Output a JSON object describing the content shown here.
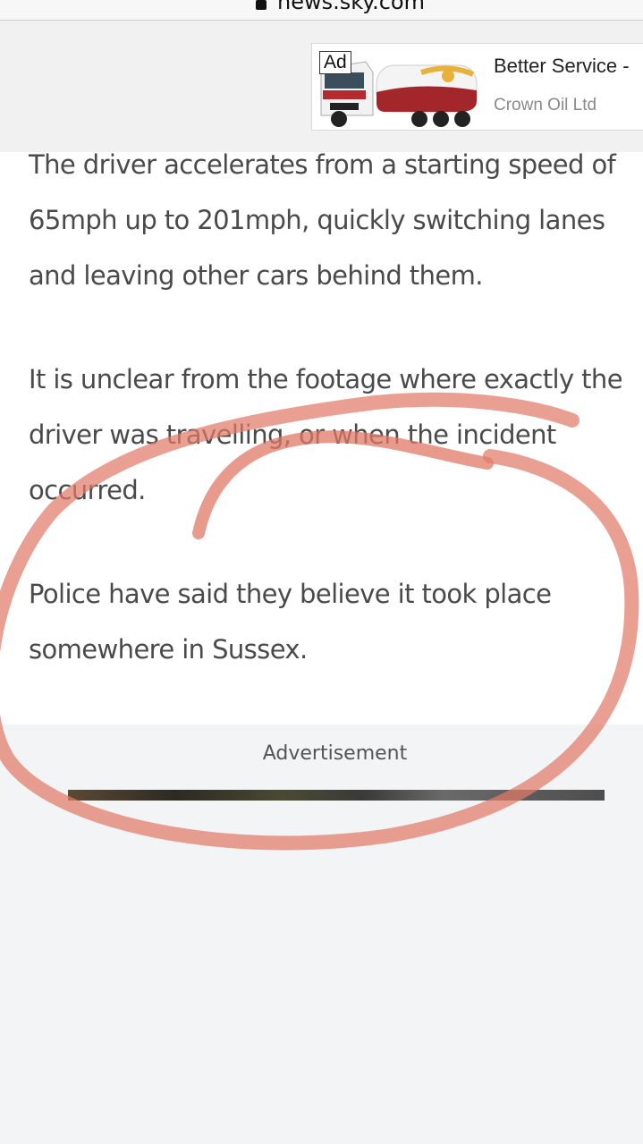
{
  "browser": {
    "url": "news.sky.com"
  },
  "ad_banner": {
    "badge": "Ad",
    "title": "Better Service -",
    "advertiser": "Crown Oil Ltd",
    "image_brand": "Crown Oil"
  },
  "article": {
    "paragraphs": [
      "The driver accelerates from a starting speed of 65mph up to 201mph, quickly switching lanes and leaving other cars behind them.",
      "It is unclear from the footage where exactly the driver was travelling, or when the incident occurred.",
      "Police have said they believe it took place somewhere in Sussex."
    ]
  },
  "advert_section": {
    "label": "Advertisement"
  },
  "colors": {
    "annotation": "#e07a66",
    "text": "#4a4a4a",
    "background": "#f3f4f6"
  }
}
